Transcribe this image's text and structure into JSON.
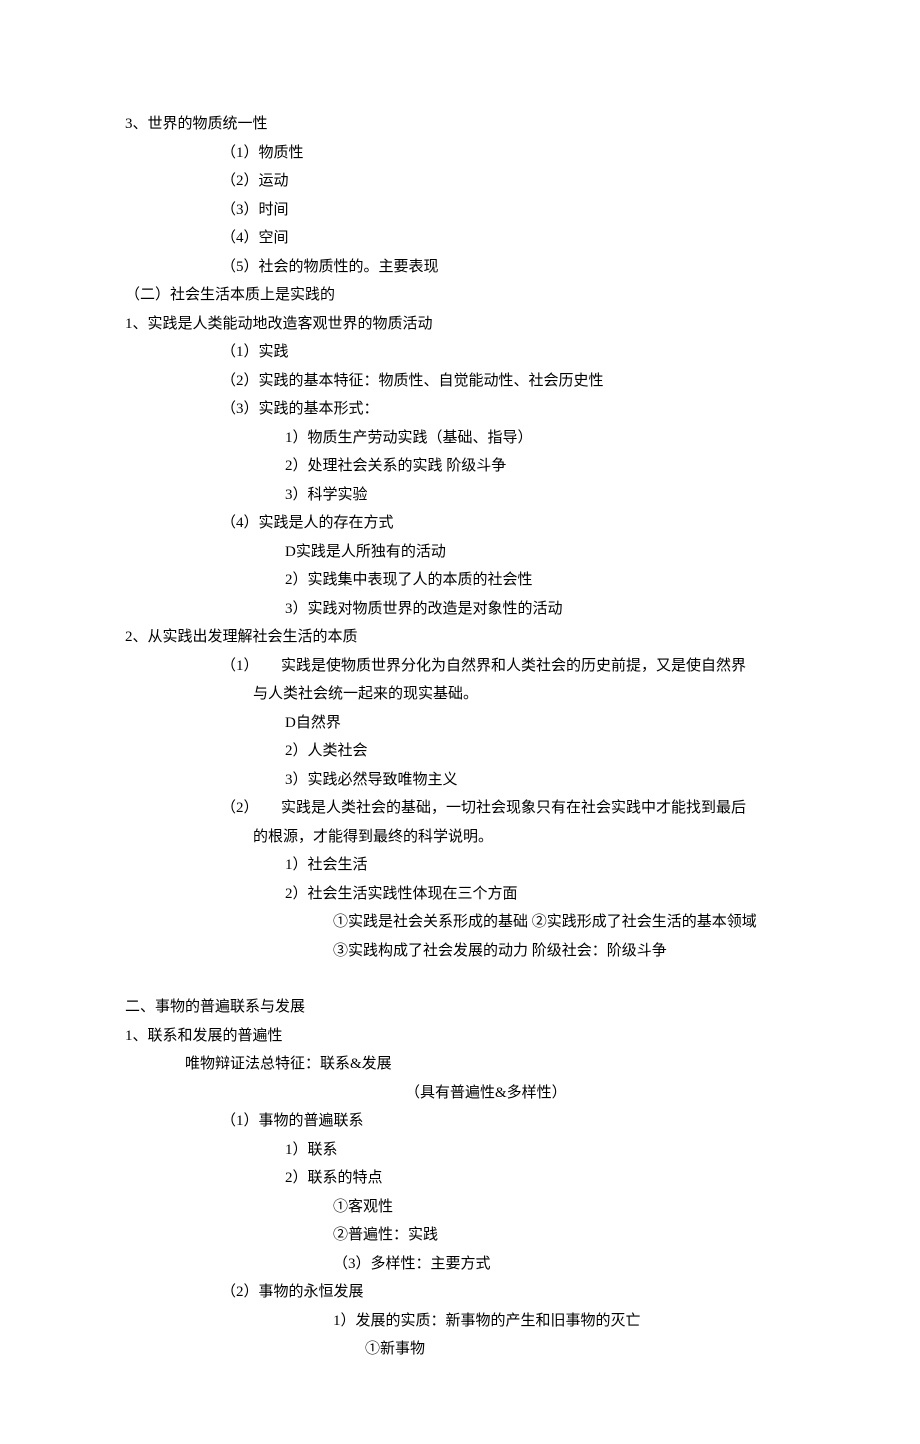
{
  "lines": [
    {
      "cls": "indent-0",
      "text": "3、世界的物质统一性"
    },
    {
      "cls": "indent-1",
      "text": "（1）物质性"
    },
    {
      "cls": "indent-1",
      "text": "（2）运动"
    },
    {
      "cls": "indent-1",
      "text": "（3）时间"
    },
    {
      "cls": "indent-1",
      "text": "（4）空间"
    },
    {
      "cls": "indent-1",
      "text": "（5）社会的物质性的。主要表现"
    },
    {
      "cls": "indent-0",
      "text": "（二）社会生活本质上是实践的"
    },
    {
      "cls": "indent-0",
      "text": "1、实践是人类能动地改造客观世界的物质活动"
    },
    {
      "cls": "indent-1",
      "text": "（1）实践"
    },
    {
      "cls": "indent-1",
      "text": "（2）实践的基本特征：物质性、自觉能动性、社会历史性"
    },
    {
      "cls": "indent-1",
      "text": "（3）实践的基本形式："
    },
    {
      "cls": "indent-2",
      "text": "1）物质生产劳动实践（基础、指导）"
    },
    {
      "cls": "indent-2",
      "text": "2）处理社会关系的实践 阶级斗争"
    },
    {
      "cls": "indent-2",
      "text": "3）科学实验"
    },
    {
      "cls": "indent-1",
      "text": "（4）实践是人的存在方式"
    },
    {
      "cls": "indent-2",
      "text": "D实践是人所独有的活动"
    },
    {
      "cls": "indent-2",
      "text": "2）实践集中表现了人的本质的社会性"
    },
    {
      "cls": "indent-2",
      "text": "3）实践对物质世界的改造是对象性的活动"
    },
    {
      "cls": "indent-0",
      "text": "2、从实践出发理解社会生活的本质"
    },
    {
      "cls": "indent-hang",
      "text": "（1）　　实践是使物质世界分化为自然界和人类社会的历史前提，又是使自然界"
    },
    {
      "cls": "indent-hang-body",
      "text": "与人类社会统一起来的现实基础。"
    },
    {
      "cls": "indent-2",
      "text": "D自然界"
    },
    {
      "cls": "indent-2",
      "text": "2）人类社会"
    },
    {
      "cls": "indent-2",
      "text": "3）实践必然导致唯物主义"
    },
    {
      "cls": "indent-hang",
      "text": "（2）　　实践是人类社会的基础，一切社会现象只有在社会实践中才能找到最后"
    },
    {
      "cls": "indent-hang-body",
      "text": "的根源，才能得到最终的科学说明。"
    },
    {
      "cls": "indent-2",
      "text": "1）社会生活"
    },
    {
      "cls": "indent-2",
      "text": "2）社会生活实践性体现在三个方面"
    },
    {
      "cls": "indent-3",
      "text": "①实践是社会关系形成的基础 ②实践形成了社会生活的基本领域"
    },
    {
      "cls": "indent-3",
      "text": "③实践构成了社会发展的动力 阶级社会：阶级斗争"
    },
    {
      "cls": "spacer",
      "text": ""
    },
    {
      "cls": "indent-0",
      "text": "二、事物的普遍联系与发展"
    },
    {
      "cls": "indent-0",
      "text": "1、联系和发展的普遍性"
    },
    {
      "cls": "indent-0",
      "text": "　　　　唯物辩证法总特征：联系&发展"
    },
    {
      "cls": "center-note",
      "text": "（具有普遍性&多样性）"
    },
    {
      "cls": "indent-1",
      "text": "（1）事物的普遍联系"
    },
    {
      "cls": "indent-2",
      "text": "1）联系"
    },
    {
      "cls": "indent-2",
      "text": "2）联系的特点"
    },
    {
      "cls": "indent-3",
      "text": "①客观性"
    },
    {
      "cls": "indent-3",
      "text": "②普遍性：实践"
    },
    {
      "cls": "indent-3",
      "text": "（3）多样性：主要方式"
    },
    {
      "cls": "indent-1",
      "text": "（2）事物的永恒发展"
    },
    {
      "cls": "indent-3",
      "text": "1）发展的实质：新事物的产生和旧事物的灭亡"
    },
    {
      "cls": "indent-4",
      "text": "①新事物"
    }
  ]
}
